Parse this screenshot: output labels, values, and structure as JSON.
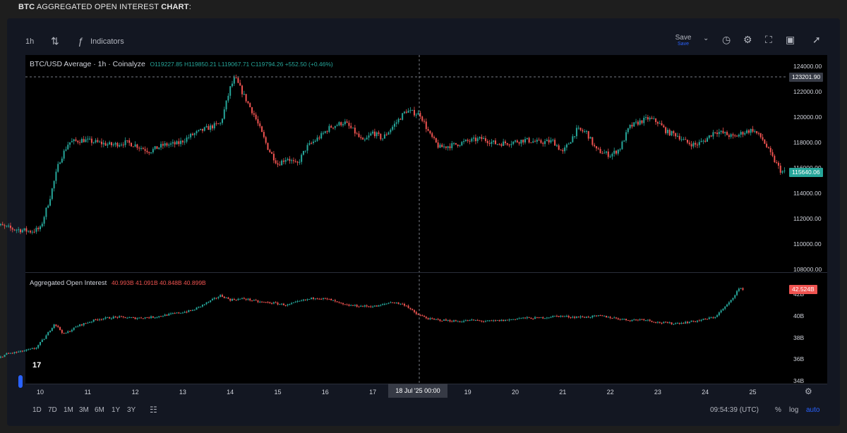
{
  "page_title": {
    "bold1": "BTC",
    "normal": " AGGREGATED OPEN INTEREST ",
    "bold2": "CHART",
    "suffix": ":"
  },
  "toolbar": {
    "interval": "1h",
    "indicators_label": "Indicators",
    "save_label": "Save",
    "save_sub": "Save"
  },
  "legend_price": {
    "title": "BTC/USD Average · 1h · Coinalyze",
    "values": "O119227.85  H119850.21  L119067.71  C119794.26  +552.50 (+0.46%)"
  },
  "legend_oi": {
    "title": "Aggregated Open Interest",
    "values": "40.993B  41.091B  40.848B  40.899B"
  },
  "price_scale_labels": [
    "124000.00",
    "122000.00",
    "120000.00",
    "118000.00",
    "116000.00",
    "114000.00",
    "112000.00",
    "110000.00",
    "108000.00"
  ],
  "oi_scale_labels": [
    "42B",
    "40B",
    "38B",
    "36B",
    "34B"
  ],
  "crosshair_price_tag": "123201.90",
  "last_price_tag": "115640.06",
  "oi_last_tag": "42.524B",
  "crosshair_time_tag": "18 Jul '25   00:00",
  "time_labels": [
    "10",
    "11",
    "12",
    "13",
    "14",
    "15",
    "16",
    "17",
    "19",
    "20",
    "21",
    "22",
    "23",
    "24",
    "25"
  ],
  "range_buttons": [
    "1D",
    "7D",
    "1M",
    "3M",
    "6M",
    "1Y",
    "3Y"
  ],
  "timezone_clock": "09:54:39 (UTC)",
  "scale_options": {
    "percent": "%",
    "log": "log",
    "auto": "auto"
  },
  "colors": {
    "up": "#26a69a",
    "down": "#ef5350",
    "background": "#000000",
    "accent": "#2962ff"
  },
  "chart_data": [
    {
      "type": "candlestick",
      "title": "BTC/USD Average · 1h · Coinalyze",
      "x": [
        "10",
        "11",
        "12",
        "13",
        "14",
        "15",
        "16",
        "17",
        "18",
        "19",
        "20",
        "21",
        "22",
        "23",
        "24",
        "25"
      ],
      "ylim": [
        107000,
        125000
      ],
      "close_anchors": [
        [
          9.0,
          109200
        ],
        [
          9.1,
          111500
        ],
        [
          9.4,
          111200
        ],
        [
          9.8,
          111000
        ],
        [
          10.0,
          111200
        ],
        [
          10.2,
          113600
        ],
        [
          10.4,
          116500
        ],
        [
          10.6,
          118000
        ],
        [
          10.9,
          118200
        ],
        [
          11.2,
          118000
        ],
        [
          11.5,
          117800
        ],
        [
          11.8,
          118000
        ],
        [
          12.0,
          117800
        ],
        [
          12.3,
          117300
        ],
        [
          12.6,
          117800
        ],
        [
          12.9,
          117900
        ],
        [
          13.2,
          118600
        ],
        [
          13.5,
          119100
        ],
        [
          13.8,
          119500
        ],
        [
          14.0,
          122300
        ],
        [
          14.1,
          123100
        ],
        [
          14.3,
          121600
        ],
        [
          14.5,
          120200
        ],
        [
          14.8,
          117500
        ],
        [
          15.0,
          116300
        ],
        [
          15.2,
          116800
        ],
        [
          15.4,
          116200
        ],
        [
          15.6,
          117600
        ],
        [
          15.9,
          118500
        ],
        [
          16.1,
          119200
        ],
        [
          16.4,
          119600
        ],
        [
          16.6,
          118900
        ],
        [
          16.8,
          118000
        ],
        [
          17.0,
          118800
        ],
        [
          17.2,
          118300
        ],
        [
          17.5,
          119600
        ],
        [
          17.7,
          120500
        ],
        [
          18.0,
          120200
        ],
        [
          18.2,
          118600
        ],
        [
          18.4,
          117600
        ],
        [
          18.7,
          117800
        ],
        [
          19.0,
          118100
        ],
        [
          19.3,
          118300
        ],
        [
          19.6,
          117900
        ],
        [
          19.9,
          118000
        ],
        [
          20.2,
          118200
        ],
        [
          20.5,
          118000
        ],
        [
          20.8,
          118100
        ],
        [
          21.0,
          117200
        ],
        [
          21.3,
          119000
        ],
        [
          21.5,
          118800
        ],
        [
          21.7,
          117400
        ],
        [
          22.0,
          117000
        ],
        [
          22.2,
          117500
        ],
        [
          22.4,
          119200
        ],
        [
          22.6,
          119600
        ],
        [
          22.8,
          119900
        ],
        [
          23.0,
          119600
        ],
        [
          23.2,
          118800
        ],
        [
          23.4,
          118600
        ],
        [
          23.6,
          118000
        ],
        [
          23.8,
          117800
        ],
        [
          24.0,
          118200
        ],
        [
          24.2,
          118900
        ],
        [
          24.4,
          118700
        ],
        [
          24.6,
          118400
        ],
        [
          24.8,
          118800
        ],
        [
          25.0,
          119000
        ],
        [
          25.2,
          118300
        ],
        [
          25.4,
          116900
        ],
        [
          25.6,
          115700
        ],
        [
          25.7,
          115640
        ]
      ],
      "last_close": 115640.06
    },
    {
      "type": "candlestick",
      "title": "Aggregated Open Interest",
      "unit": "B",
      "x": [
        "10",
        "11",
        "12",
        "13",
        "14",
        "15",
        "16",
        "17",
        "18",
        "19",
        "20",
        "21",
        "22",
        "23",
        "24",
        "25"
      ],
      "ylim": [
        33.5,
        43.5
      ],
      "close_anchors": [
        [
          9.0,
          35.8
        ],
        [
          9.3,
          36.5
        ],
        [
          9.6,
          36.7
        ],
        [
          9.9,
          37.0
        ],
        [
          10.1,
          38.0
        ],
        [
          10.3,
          39.3
        ],
        [
          10.5,
          38.3
        ],
        [
          10.8,
          39.1
        ],
        [
          11.2,
          39.7
        ],
        [
          11.6,
          39.9
        ],
        [
          12.0,
          39.8
        ],
        [
          12.4,
          39.9
        ],
        [
          12.8,
          40.2
        ],
        [
          13.2,
          40.5
        ],
        [
          13.5,
          41.2
        ],
        [
          13.8,
          41.9
        ],
        [
          14.0,
          41.5
        ],
        [
          14.3,
          41.6
        ],
        [
          14.6,
          41.3
        ],
        [
          14.9,
          41.2
        ],
        [
          15.2,
          41.0
        ],
        [
          15.5,
          41.4
        ],
        [
          15.8,
          41.7
        ],
        [
          16.1,
          41.5
        ],
        [
          16.4,
          41.0
        ],
        [
          16.8,
          40.9
        ],
        [
          17.1,
          40.9
        ],
        [
          17.4,
          41.3
        ],
        [
          17.7,
          41.0
        ],
        [
          17.9,
          40.2
        ],
        [
          18.2,
          39.7
        ],
        [
          18.5,
          39.6
        ],
        [
          18.8,
          39.5
        ],
        [
          19.1,
          39.6
        ],
        [
          19.4,
          39.5
        ],
        [
          19.8,
          39.6
        ],
        [
          20.1,
          39.8
        ],
        [
          20.5,
          39.8
        ],
        [
          20.9,
          40.0
        ],
        [
          21.2,
          39.9
        ],
        [
          21.5,
          39.9
        ],
        [
          21.8,
          40.0
        ],
        [
          22.1,
          39.8
        ],
        [
          22.4,
          39.6
        ],
        [
          22.7,
          39.7
        ],
        [
          23.0,
          39.4
        ],
        [
          23.3,
          39.3
        ],
        [
          23.6,
          39.4
        ],
        [
          23.9,
          39.6
        ],
        [
          24.2,
          39.9
        ],
        [
          24.5,
          41.2
        ],
        [
          24.7,
          42.5
        ],
        [
          24.8,
          42.5
        ]
      ],
      "last_value": "42.524B"
    }
  ]
}
